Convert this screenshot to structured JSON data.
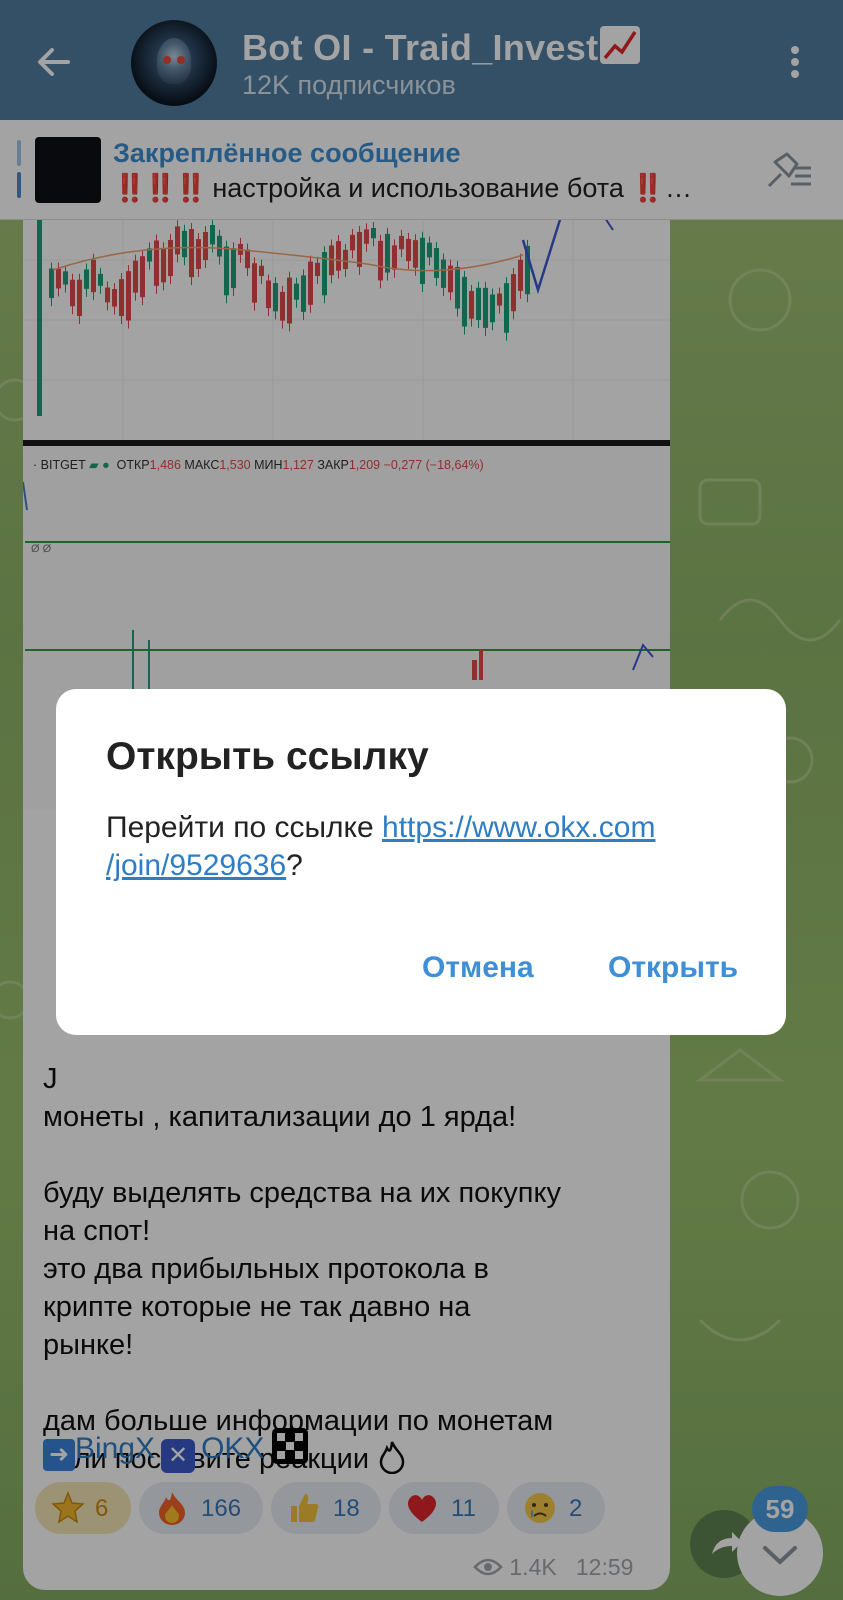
{
  "header": {
    "title": "Bot OI - Traid_Invest",
    "subtitle": "12K подписчиков",
    "back_icon": "arrow-left-icon",
    "more_icon": "more-vertical-icon"
  },
  "pinned": {
    "title": "Закреплённое сообщение",
    "prefix": "‼️‼️‼️",
    "text": "настройка и использование бота ‼️…"
  },
  "chart": {
    "exchange": "BITGET",
    "open_label": "ОТКР",
    "open_value": "1,486",
    "high_label": "МАКС",
    "high_value": "1,530",
    "low_label": "МИН",
    "low_value": "1,127",
    "close_label": "ЗАКР",
    "close_value": "1,209",
    "change": "−0,277 (−18,64%)",
    "indicator_label": "Ø Ø",
    "colors": {
      "up": "#1ea07a",
      "down": "#e04a4a",
      "level": "#2e9e3e"
    }
  },
  "message": {
    "partial_line1": "J",
    "partial_line2": "монеты , капитализации до 1 ярда!",
    "para1_line1": "буду выделять средства на их покупку",
    "para1_line2": "на спот!",
    "para1_line3": "это два прибыльных протокола в",
    "para1_line4": "крипте которые не так давно на",
    "para1_line5": "рынке!",
    "para2_line1": "дам больше информации по монетам",
    "para2_line2": "если поставите реакции",
    "link_bingx": "BingX",
    "link_okx": "OKX",
    "reactions": [
      {
        "emoji": "star-icon",
        "count": "6"
      },
      {
        "emoji": "fire-icon",
        "count": "166"
      },
      {
        "emoji": "thumbs-up-icon",
        "count": "18"
      },
      {
        "emoji": "heart-icon",
        "count": "11"
      },
      {
        "emoji": "crying-face-icon",
        "count": "2"
      }
    ],
    "views": "1.4K",
    "time": "12:59"
  },
  "unread_count": "59",
  "dialog": {
    "title": "Открыть ссылку",
    "body_prefix": "Перейти по ссылке ",
    "link_line1": "https://www.okx.com",
    "link_line2": "/join/9529636",
    "body_suffix": "?",
    "cancel_label": "Отмена",
    "open_label": "Открыть"
  }
}
